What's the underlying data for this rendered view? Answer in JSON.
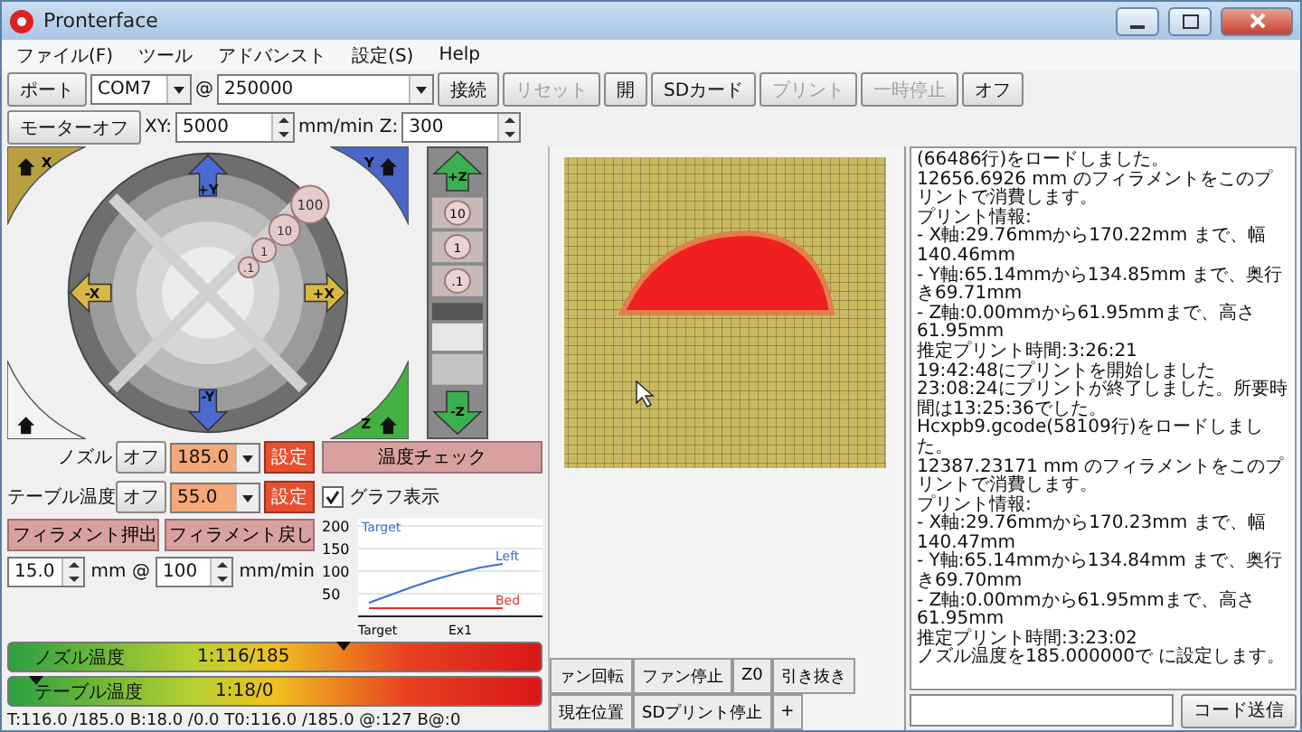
{
  "window": {
    "title": "Pronterface"
  },
  "menu": [
    "ファイル(F)",
    "ツール",
    "アドバンスト",
    "設定(S)",
    "Help"
  ],
  "toolbar": {
    "port_button": "ポート",
    "port": "COM7",
    "at": "@",
    "baud": "250000",
    "buttons": [
      {
        "label": "接続",
        "disabled": false
      },
      {
        "label": "リセット",
        "disabled": true
      },
      {
        "label": "開",
        "disabled": false
      },
      {
        "label": "SDカード",
        "disabled": false
      },
      {
        "label": "プリント",
        "disabled": true
      },
      {
        "label": "一時停止",
        "disabled": true
      },
      {
        "label": "オフ",
        "disabled": false
      }
    ]
  },
  "motion_bar": {
    "motors_off": "モーターオフ",
    "xy_label": "XY:",
    "xy_speed": "5000",
    "z_label": "mm/min Z:",
    "z_speed": "300"
  },
  "jog": {
    "y_plus": "+Y",
    "y_minus": "-Y",
    "x_minus": "-X",
    "x_plus": "+X",
    "home_x": "X",
    "home_y": "Y",
    "home_z": "Z",
    "steps": [
      "100",
      "10",
      "1",
      ".1"
    ]
  },
  "z_jog": {
    "up": "+Z",
    "down": "-Z",
    "steps": [
      "10",
      "1",
      ".1"
    ]
  },
  "temps": [
    {
      "label": "ノズル",
      "off": "オフ",
      "value": "185.0",
      "set": "設定"
    },
    {
      "label": "テーブル温度",
      "off": "オフ",
      "value": "55.0",
      "set": "設定"
    }
  ],
  "temp_check": "温度チェック",
  "graph_toggle": {
    "label": "グラフ表示",
    "checked": true
  },
  "extrude": {
    "buttons": [
      "フィラメント押出",
      "フィラメント戻し"
    ],
    "length": "15.0",
    "length_unit": "mm @",
    "speed": "100",
    "speed_unit": "mm/min"
  },
  "graph": {
    "chart_data": {
      "type": "line",
      "ylim": [
        0,
        200
      ],
      "yticks": [
        50,
        100,
        150,
        200
      ],
      "series": [
        {
          "name": "Left",
          "color": "#3b6fd6",
          "values": [
            30,
            48,
            66,
            82,
            96,
            108,
            116
          ]
        },
        {
          "name": "Bed",
          "color": "#e0302a",
          "values": [
            18,
            18,
            18,
            18,
            18,
            18,
            18
          ]
        }
      ],
      "grid": true,
      "annotations": [
        "Target",
        "Target",
        "Ex1"
      ]
    }
  },
  "gauges": [
    {
      "label": "ノズル温度",
      "reading": "1:116/185",
      "level": 0.63
    },
    {
      "label": "テーブル温度",
      "reading": "1:18/0",
      "level": 0.05
    }
  ],
  "status_bar": "T:116.0 /185.0 B:18.0 /0.0 T0:116.0 /185.0 @:127 B@:0",
  "controls": [
    {
      "buttons": [
        "ァン回転",
        "ファン停止",
        "Z0",
        "引き抜き"
      ]
    },
    {
      "buttons": [
        "現在位置",
        "SDプリント停止",
        "+"
      ]
    }
  ],
  "log": [
    "(66486行)をロードしました。",
    "12656.6926 mm のフィラメントをこのプリントで消費します。",
    "プリント情報:",
    "- X軸:29.76mmから170.22mm まで、幅140.46mm",
    "- Y軸:65.14mmから134.85mm まで、奥行き69.71mm",
    "- Z軸:0.00mmから61.95mmまで、高さ61.95mm",
    "推定プリント時間:3:26:21",
    "19:42:48にプリントを開始しました",
    "23:08:24にプリントが終了しました。所要時間は13:25:36でした。",
    "Hcxpb9.gcode(58109行)をロードしました。",
    "12387.23171 mm のフィラメントをこのプリントで消費します。",
    "プリント情報:",
    "- X軸:29.76mmから170.23mm まで、幅140.47mm",
    "- Y軸:65.14mmから134.84mm まで、奥行き69.70mm",
    "- Z軸:0.00mmから61.95mmまで、高さ61.95mm",
    "推定プリント時間:3:23:02",
    "ノズル温度を185.000000で に設定します。"
  ],
  "command": {
    "send": "コード送信"
  }
}
